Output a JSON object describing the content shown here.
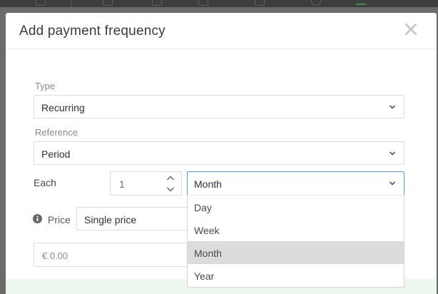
{
  "modal": {
    "title": "Add payment frequency",
    "close_label": "×"
  },
  "form": {
    "type": {
      "label": "Type",
      "value": "Recurring"
    },
    "reference": {
      "label": "Reference",
      "value": "Period"
    },
    "each": {
      "label": "Each",
      "quantity": "1",
      "unit": "Month"
    },
    "price": {
      "label": "Price",
      "mode": "Single price",
      "amount_placeholder": "€ 0.00"
    }
  },
  "dropdown": {
    "options": [
      "Day",
      "Week",
      "Month",
      "Year"
    ],
    "highlighted": "Month"
  },
  "icons": {
    "close": "close-icon",
    "chevron": "chevron-down-icon",
    "info": "info-icon",
    "step_up": "chevron-up-icon",
    "step_down": "chevron-down-icon"
  },
  "colors": {
    "focus_border": "#5a9bd4",
    "highlight": "#dcdcdc",
    "footer_tint": "#ecf7ef"
  }
}
